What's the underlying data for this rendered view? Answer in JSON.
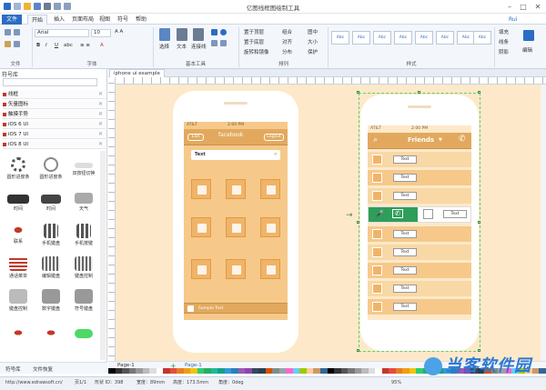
{
  "app": {
    "title": "亿图线框图绘制工具",
    "menu": [
      "文件",
      "开始",
      "插入",
      "页面布局",
      "视图",
      "符号",
      "帮助"
    ],
    "user": "Rui",
    "window_controls": [
      "–",
      "□",
      "✕"
    ]
  },
  "ribbon": {
    "font_name": "Arial",
    "font_size": "10",
    "groups": [
      "文件",
      "字体",
      "基本工具",
      "排列",
      "样式",
      "编辑"
    ],
    "tool_labels": {
      "select": "选择",
      "text": "文本",
      "connector": "连接线"
    },
    "arrange_items": [
      "置于顶层",
      "置于底层",
      "旋转和镜像",
      "组合",
      "对齐",
      "分布",
      "图中",
      "大小",
      "保护"
    ],
    "style_swatches": [
      "Abc",
      "Abc",
      "Abc",
      "Abc",
      "Abc",
      "Abc",
      "Abc",
      "Abc"
    ],
    "right_items": [
      "填充",
      "线条",
      "阴影"
    ],
    "edit_label": "编辑"
  },
  "library": {
    "title": "符号库",
    "categories": [
      "线框",
      "矢量图标",
      "触摸手势",
      "iOS 6 UI",
      "iOS 7 UI",
      "iOS 8 UI"
    ],
    "shapes": [
      {
        "label": "圆形进度条"
      },
      {
        "label": "圆形进度条"
      },
      {
        "label": "双按钮切换"
      },
      {
        "label": "时间"
      },
      {
        "label": "时间"
      },
      {
        "label": "天气"
      },
      {
        "label": "联系"
      },
      {
        "label": "手机键盘"
      },
      {
        "label": "手机按键"
      },
      {
        "label": "通话菜单"
      },
      {
        "label": "编辑键盘"
      },
      {
        "label": "键盘控制"
      },
      {
        "label": "键盘控制"
      },
      {
        "label": "数字键盘"
      },
      {
        "label": "符号键盘"
      }
    ],
    "tabs": [
      "符号库",
      "文件恢复"
    ]
  },
  "document": {
    "tab": "iphone ui example",
    "page_tab": "Page-1",
    "page_tab2": "Page-1"
  },
  "phone1": {
    "carrier": "AT&T",
    "time": "2:00 PM",
    "header_title": "facebook",
    "btn_left": "Exit",
    "btn_right": "Logout",
    "search_text": "Text",
    "footer_text": "Sample Text"
  },
  "phone2": {
    "carrier": "AT&T",
    "time": "2:00 PM",
    "header_title": "Friends",
    "row_text": "Text",
    "rows": 9
  },
  "status": {
    "url": "http://www.edrawsoft.cn/",
    "page": "页1/1",
    "shape_id": "形状 ID：398",
    "width": "宽度：89mm",
    "height": "高度：173.5mm",
    "angle": "角度：0deg",
    "zoom": "95%"
  },
  "watermark": "当客软件园",
  "colors": {
    "accent": "#2b6cc4",
    "orange": "#f6c98a",
    "canvas": "#fde9c9"
  }
}
